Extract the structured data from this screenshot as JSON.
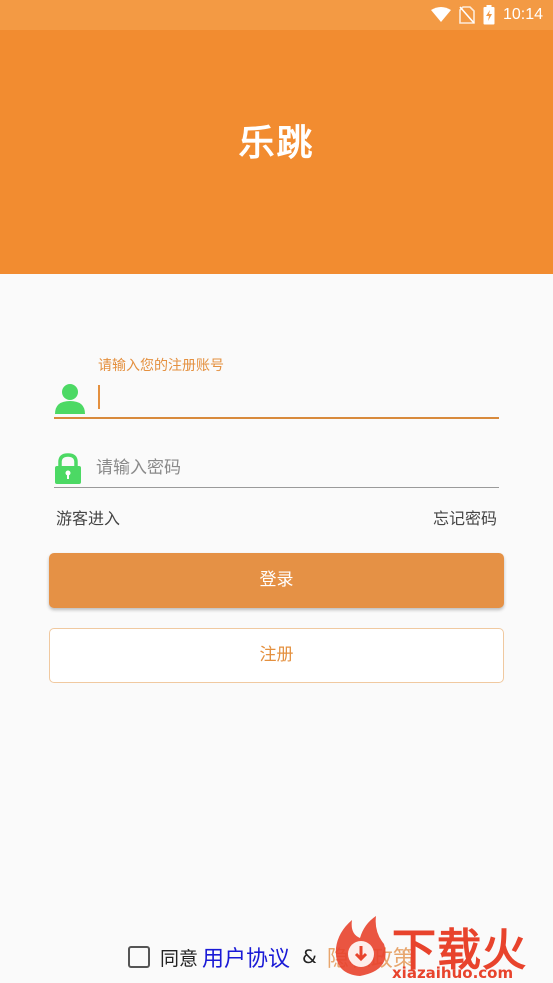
{
  "status_bar": {
    "time": "10:14",
    "icons": [
      "wifi-icon",
      "no-sim-icon",
      "battery-charging-icon"
    ]
  },
  "header": {
    "app_title": "乐跳",
    "color": "#f28c30"
  },
  "login_form": {
    "account_label": "请输入您的注册账号",
    "account_value": "",
    "password_placeholder": "请输入密码",
    "guest_link": "游客进入",
    "forgot_link": "忘记密码",
    "login_button": "登录",
    "register_button": "注册"
  },
  "agreement": {
    "prefix": "同意",
    "user_agreement": "用户协议",
    "separator": "&",
    "privacy_policy": "隐私政策"
  },
  "watermark": {
    "brand": "下载火",
    "url": "xiazaihuo.com"
  },
  "colors": {
    "accent": "#e59145",
    "icon_green": "#4cd964",
    "link_blue": "#1a1ad6"
  }
}
